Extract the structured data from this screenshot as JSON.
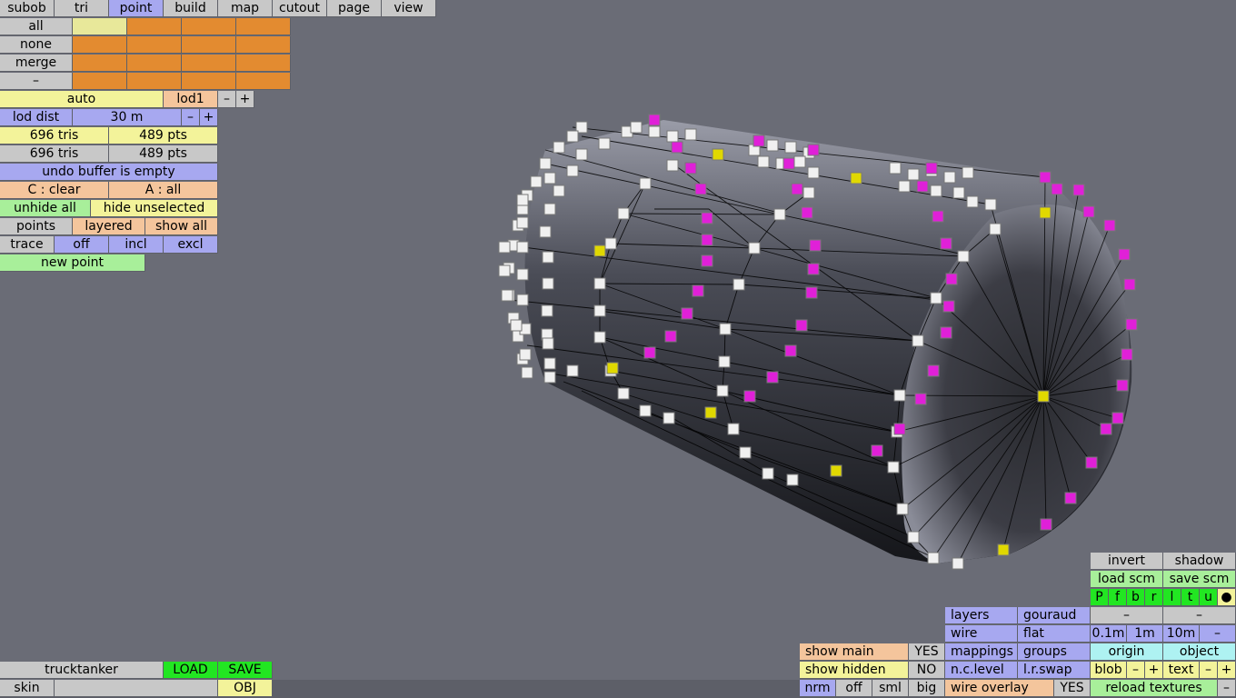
{
  "menu": [
    "subob",
    "tri",
    "point",
    "build",
    "map",
    "cutout",
    "page",
    "view"
  ],
  "menu_active": "point",
  "select": {
    "all": "all",
    "none": "none",
    "merge": "merge",
    "minus": "–"
  },
  "lod": {
    "auto": "auto",
    "level": "lod1",
    "dec": "–",
    "inc": "+"
  },
  "lod_dist": {
    "label": "lod dist",
    "value": "30 m",
    "dec": "–",
    "inc": "+"
  },
  "stats": {
    "tris_a": "696 tris",
    "pts_a": "489 pts",
    "tris_b": "696 tris",
    "pts_b": "489 pts"
  },
  "undo": "undo buffer is empty",
  "clear": {
    "c": "C : clear",
    "a": "A : all"
  },
  "hide": {
    "unhide": "unhide all",
    "unselected": "hide unselected"
  },
  "points_row": {
    "points": "points",
    "layered": "layered",
    "show_all": "show all"
  },
  "trace_row": {
    "trace": "trace",
    "off": "off",
    "incl": "incl",
    "excl": "excl"
  },
  "new_point": "new point",
  "bottom_left": {
    "name": "trucktanker",
    "load": "LOAD",
    "save": "SAVE",
    "skin": "skin",
    "obj": "OBJ"
  },
  "show": {
    "main": "show main",
    "main_val": "YES",
    "hidden": "show hidden",
    "hidden_val": "NO"
  },
  "size": {
    "nrm": "nrm",
    "off": "off",
    "sml": "sml",
    "big": "big"
  },
  "render": {
    "layers": "layers",
    "gouraud": "gouraud",
    "wire": "wire",
    "flat": "flat",
    "mappings": "mappings",
    "groups": "groups",
    "nclevel": "n.c.level",
    "lrswap": "l.r.swap",
    "wire_overlay": "wire overlay",
    "wire_overlay_val": "YES"
  },
  "right_panel": {
    "invert": "invert",
    "shadow": "shadow",
    "load_scm": "load scm",
    "save_scm": "save scm",
    "flags": [
      "P",
      "f",
      "b",
      "r",
      "l",
      "t",
      "u",
      "●"
    ],
    "minus1": "–",
    "minus2": "–",
    "grid": [
      "0.1m",
      "1m",
      "10m",
      "–"
    ],
    "origin": "origin",
    "object": "object",
    "blob": "blob",
    "blob_dec": "–",
    "blob_inc": "+",
    "text": "text",
    "text_dec": "–",
    "text_inc": "+",
    "reload": "reload textures",
    "reload_minus": "–"
  },
  "colors": {
    "background": "#6a6c76",
    "selected_point": "#e020d8",
    "anchor_point": "#e0d800",
    "vertex": "#f0f0f0"
  }
}
